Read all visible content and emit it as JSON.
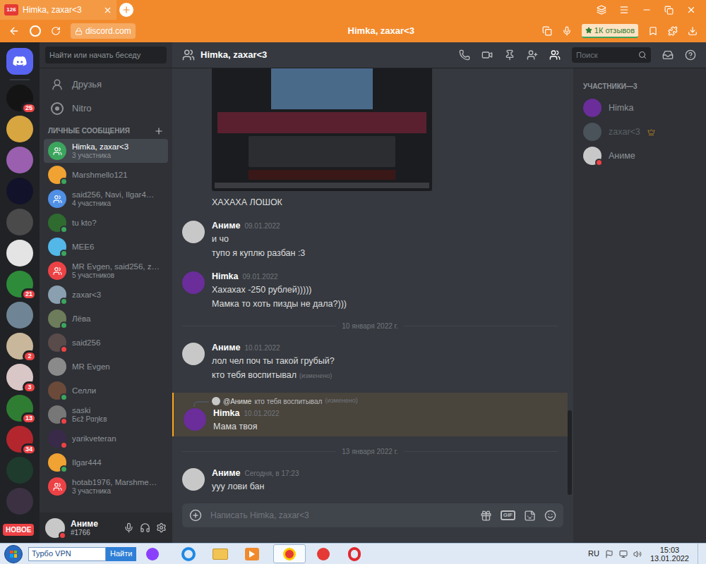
{
  "browser": {
    "tab": {
      "title": "Himka, zaxar<3",
      "badge": "126"
    },
    "address": "discord.com",
    "page_title": "Himka, zaxar<3",
    "reviews": "1К отзывов"
  },
  "servers": {
    "home": {
      "selected": true
    },
    "new_label": "НОВОЕ",
    "items": [
      {
        "badge": "25",
        "color": "#141414"
      },
      {
        "badge": "",
        "color": "#d7a640"
      },
      {
        "badge": "",
        "color": "#9b5fb0"
      },
      {
        "badge": "",
        "color": "#12122a"
      },
      {
        "badge": "",
        "color": "#4a4a4a"
      },
      {
        "badge": "",
        "color": "#e4e4e4"
      },
      {
        "badge": "21",
        "color": "#2e8b3a"
      },
      {
        "badge": "",
        "color": "#6f8596"
      },
      {
        "badge": "2",
        "color": "#c9b79b"
      },
      {
        "badge": "3",
        "color": "#d9c6c6"
      },
      {
        "badge": "13",
        "color": "#2f7d32"
      },
      {
        "badge": "34",
        "color": "#b3262e"
      },
      {
        "badge": "",
        "color": "#1e3b2d"
      },
      {
        "badge": "",
        "color": "#3b3142"
      }
    ]
  },
  "dm_sidebar": {
    "search_placeholder": "Найти или начать беседу",
    "nav": [
      {
        "label": "Друзья"
      },
      {
        "label": "Nitro"
      }
    ],
    "section_title": "ЛИЧНЫЕ СООБЩЕНИЯ",
    "items": [
      {
        "name": "Himka, zaxar<3",
        "subtitle": "3 участника",
        "kind": "group",
        "color": "#3ba55d",
        "status": "none",
        "selected": true
      },
      {
        "name": "Marshmello121",
        "subtitle": "",
        "kind": "user",
        "color": "#f0a232",
        "status": "online",
        "selected": false
      },
      {
        "name": "said256, Navi, Ilgar4…",
        "subtitle": "4 участника",
        "kind": "group",
        "color": "#4f8fe6",
        "status": "none",
        "selected": false
      },
      {
        "name": "tu kto?",
        "subtitle": "",
        "kind": "user",
        "color": "#2f6b2f",
        "status": "online",
        "selected": false
      },
      {
        "name": "MEE6",
        "subtitle": "",
        "kind": "user",
        "color": "#53b7e8",
        "status": "online",
        "selected": false
      },
      {
        "name": "MR Evgen, said256, z…",
        "subtitle": "5 участников",
        "kind": "group",
        "color": "#ed4245",
        "status": "none",
        "selected": false
      },
      {
        "name": "zaxar<3",
        "subtitle": "",
        "kind": "user",
        "color": "#8aa0b0",
        "status": "online",
        "selected": false
      },
      {
        "name": "Лёва",
        "subtitle": "",
        "kind": "user",
        "color": "#6d7c5a",
        "status": "online",
        "selected": false
      },
      {
        "name": "said256",
        "subtitle": "",
        "kind": "user",
        "color": "#5a4b4b",
        "status": "dnd",
        "selected": false
      },
      {
        "name": "MR Evgen",
        "subtitle": "",
        "kind": "user",
        "color": "#8a8a8a",
        "status": "none",
        "selected": false
      },
      {
        "name": "Селли",
        "subtitle": "",
        "kind": "user",
        "color": "#6b4a3a",
        "status": "online",
        "selected": false
      },
      {
        "name": "saski",
        "subtitle": "Бєž Pαŋłεв",
        "kind": "user",
        "color": "#777777",
        "status": "dnd",
        "selected": false
      },
      {
        "name": "yarikveteran",
        "subtitle": "",
        "kind": "user",
        "color": "#3a2a4a",
        "status": "dnd",
        "selected": false
      },
      {
        "name": "Ilgar444",
        "subtitle": "",
        "kind": "user",
        "color": "#f0a232",
        "status": "online",
        "selected": false
      },
      {
        "name": "hotab1976, Marshme…",
        "subtitle": "3 участника",
        "kind": "group",
        "color": "#ed4245",
        "status": "none",
        "selected": false
      }
    ]
  },
  "user_panel": {
    "name": "Аниме",
    "tag": "#1766",
    "status": "dnd",
    "color": "#c8c8c8"
  },
  "chat": {
    "title": "Himka, zaxar<3",
    "search_placeholder": "Поиск",
    "input_placeholder": "Написать Himka, zaxar<3",
    "gif_label": "GIF",
    "items": [
      {
        "kind": "continuation",
        "attachment": true,
        "lines": [
          {
            "text": "ХАХАХА ЛОШОК",
            "edited": ""
          }
        ]
      },
      {
        "kind": "group",
        "author": "Аниме",
        "time": "09.01.2022",
        "color": "#c8c8c8",
        "highlighted": false,
        "reply": null,
        "lines": [
          {
            "text": "и чо",
            "edited": ""
          },
          {
            "text": "тупо я куплю разбан :3",
            "edited": ""
          }
        ]
      },
      {
        "kind": "group",
        "author": "Himka",
        "time": "09.01.2022",
        "color": "#6a2d9a",
        "highlighted": false,
        "reply": null,
        "lines": [
          {
            "text": "Хахахах -250 рублей)))))",
            "edited": ""
          },
          {
            "text": "Мамка то хоть пизды не дала?)))",
            "edited": ""
          }
        ]
      },
      {
        "kind": "divider",
        "label": "10 января 2022 г."
      },
      {
        "kind": "group",
        "author": "Аниме",
        "time": "10.01.2022",
        "color": "#c8c8c8",
        "highlighted": false,
        "reply": null,
        "lines": [
          {
            "text": "лол чел поч ты такой грубый?",
            "edited": ""
          },
          {
            "text": "кто тебя воспитывал",
            "edited": "(изменено)"
          }
        ]
      },
      {
        "kind": "group",
        "author": "Himka",
        "time": "10.01.2022",
        "color": "#6a2d9a",
        "highlighted": true,
        "reply": {
          "mention": "@Аниме",
          "text": "кто тебя воспитывал",
          "edited": "(изменено)",
          "color": "#c8c8c8"
        },
        "lines": [
          {
            "text": "Мама твоя",
            "edited": ""
          }
        ]
      },
      {
        "kind": "divider",
        "label": "13 января 2022 г."
      },
      {
        "kind": "group",
        "author": "Аниме",
        "time": "Сегодня, в 17:23",
        "color": "#c8c8c8",
        "highlighted": false,
        "reply": null,
        "lines": [
          {
            "text": "ууу лови бан",
            "edited": ""
          }
        ]
      }
    ]
  },
  "members": {
    "title": "УЧАСТНИКИ—3",
    "items": [
      {
        "name": "Himka",
        "color": "#6a2d9a",
        "status": "none",
        "offline": false,
        "owner": false
      },
      {
        "name": "zaxar<3",
        "color": "#8aa0b0",
        "status": "none",
        "offline": true,
        "owner": true
      },
      {
        "name": "Аниме",
        "color": "#c8c8c8",
        "status": "dnd",
        "offline": false,
        "owner": false
      }
    ]
  },
  "taskbar": {
    "search_value": "Турбо VPN",
    "search_button": "Найти",
    "lang": "RU",
    "time": "15:03",
    "date": "13.01.2022"
  }
}
